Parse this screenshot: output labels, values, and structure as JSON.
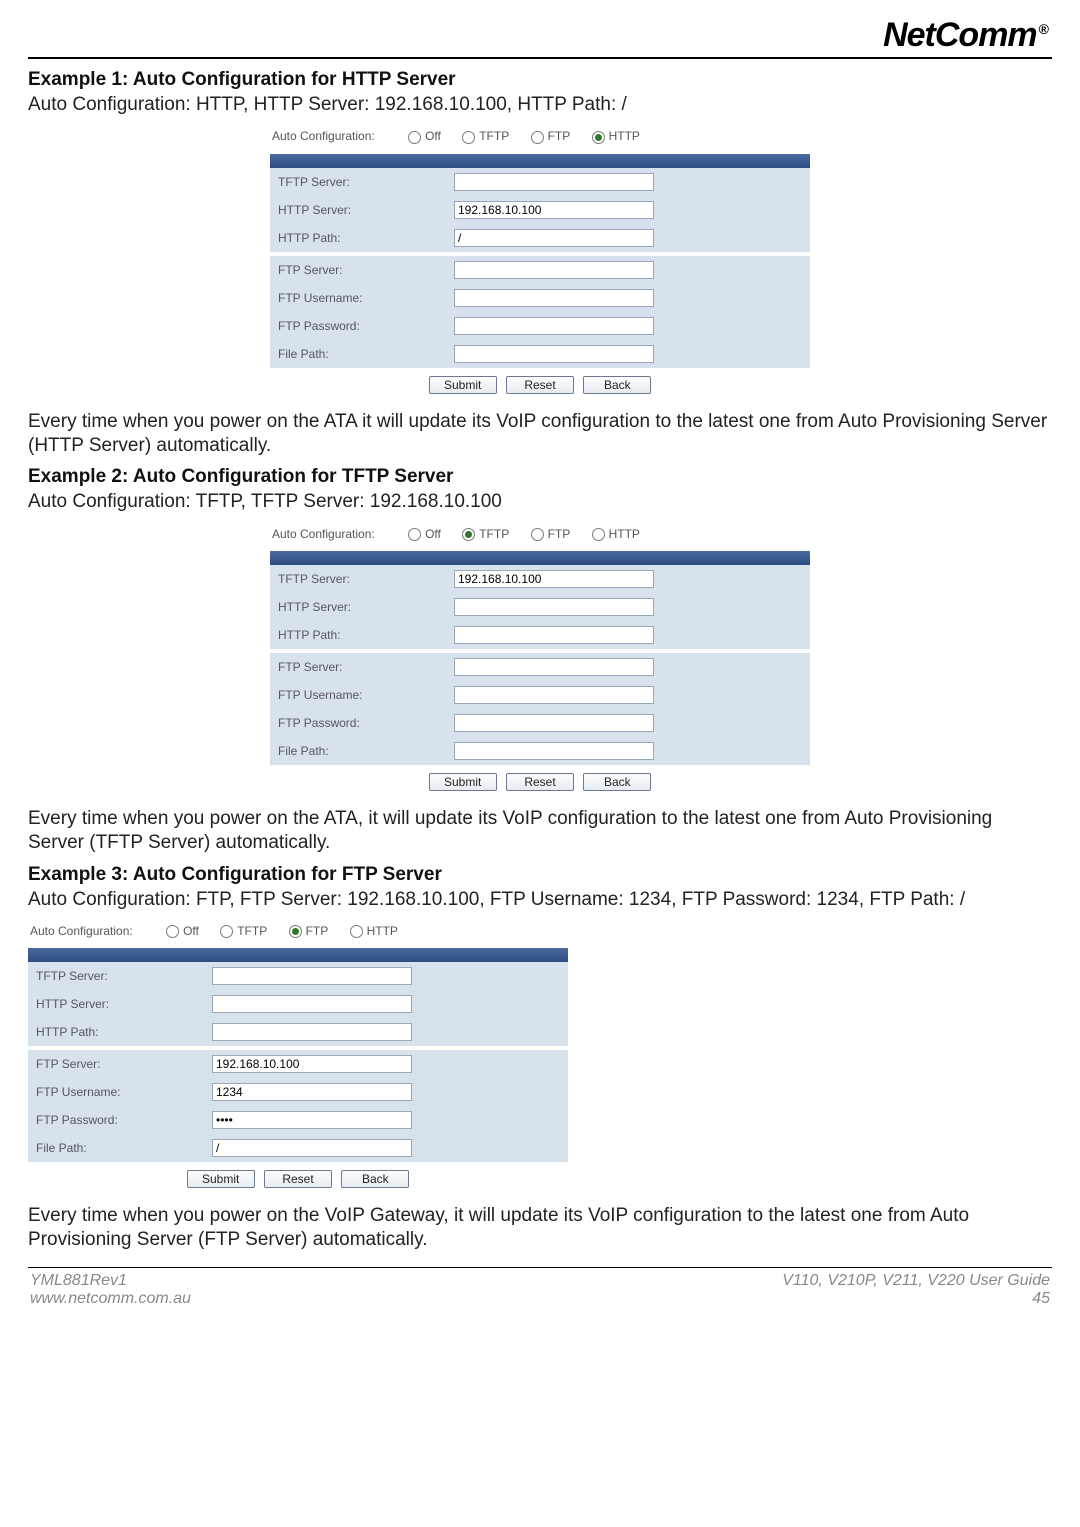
{
  "logo": {
    "text": "NetComm",
    "reg": "®"
  },
  "example1": {
    "title": "Example 1: Auto Configuration for HTTP Server",
    "subtitle": "Auto Configuration: HTTP, HTTP Server: 192.168.10.100, HTTP Path: /",
    "after": "Every time when you power on the ATA it will update its VoIP configuration to the latest one from Auto Provisioning Server (HTTP Server) automatically."
  },
  "example2": {
    "title": "Example 2: Auto Configuration for TFTP Server",
    "subtitle": "Auto Configuration: TFTP, TFTP Server: 192.168.10.100",
    "after": "Every time when you power on the ATA, it will update its VoIP configuration to the latest one from Auto Provisioning Server (TFTP Server) automatically."
  },
  "example3": {
    "title": "Example 3: Auto Configuration for FTP Server",
    "subtitle": "Auto Configuration: FTP, FTP Server: 192.168.10.100, FTP Username: 1234, FTP Password: 1234, FTP Path: /",
    "after": "Every time when you power on the VoIP Gateway, it will update its VoIP configuration to the latest one from Auto Provisioning Server (FTP Server) automatically."
  },
  "form_labels": {
    "auto_config": "Auto Configuration:",
    "opts": {
      "off": "Off",
      "tftp": "TFTP",
      "ftp": "FTP",
      "http": "HTTP"
    },
    "tftp_server": "TFTP Server:",
    "http_server": "HTTP Server:",
    "http_path": "HTTP Path:",
    "ftp_server": "FTP Server:",
    "ftp_user": "FTP Username:",
    "ftp_pass": "FTP Password:",
    "file_path": "File Path:"
  },
  "buttons": {
    "submit": "Submit",
    "reset": "Reset",
    "back": "Back"
  },
  "values": {
    "block1": {
      "tftp": "",
      "http_server": "192.168.10.100",
      "http_path": "/",
      "ftp_server": "",
      "ftp_user": "",
      "ftp_pass": "",
      "file_path": ""
    },
    "block2": {
      "tftp": "192.168.10.100",
      "http_server": "",
      "http_path": "",
      "ftp_server": "",
      "ftp_user": "",
      "ftp_pass": "",
      "file_path": ""
    },
    "block3": {
      "tftp": "",
      "http_server": "",
      "http_path": "",
      "ftp_server": "192.168.10.100",
      "ftp_user": "1234",
      "ftp_pass": "••••",
      "file_path": "/"
    }
  },
  "footer": {
    "left1": "YML881Rev1",
    "left2": "www.netcomm.com.au",
    "right1": "V110, V210P, V211, V220 User Guide",
    "right2": "45"
  }
}
